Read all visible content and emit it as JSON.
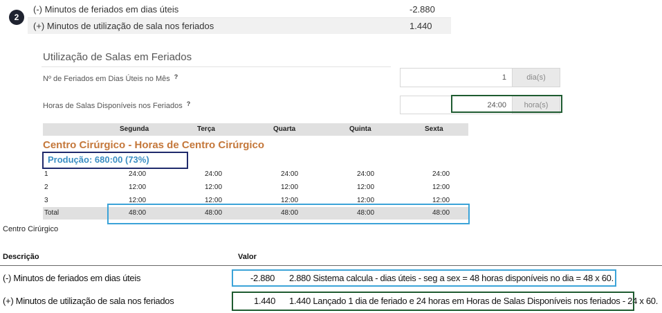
{
  "step_badge": "2",
  "top_summary": {
    "rows": [
      {
        "label": "(-) Minutos de feriados em dias úteis",
        "value": "-2.880"
      },
      {
        "label": "(+) Minutos de utilização de sala nos feriados",
        "value": "1.440"
      }
    ]
  },
  "form": {
    "title": "Utilização de Salas em Feriados",
    "fields": [
      {
        "label": "Nº de Feriados em Dias Úteis no Mês",
        "help": "?",
        "value": "1",
        "unit": "dia(s)"
      },
      {
        "label": "Horas de Salas Disponíveis nos Feriados",
        "help": "?",
        "value": "24:00",
        "unit": "hora(s)"
      }
    ]
  },
  "schedule": {
    "days": [
      "Segunda",
      "Terça",
      "Quarta",
      "Quinta",
      "Sexta"
    ],
    "center_title": "Centro Cirúrgico - Horas de Centro Cirúrgico",
    "production": "Produção: 680:00 (73%)",
    "rows": [
      {
        "label": "1",
        "values": [
          "24:00",
          "24:00",
          "24:00",
          "24:00",
          "24:00"
        ]
      },
      {
        "label": "2",
        "values": [
          "12:00",
          "12:00",
          "12:00",
          "12:00",
          "12:00"
        ]
      },
      {
        "label": "3",
        "values": [
          "12:00",
          "12:00",
          "12:00",
          "12:00",
          "12:00"
        ]
      },
      {
        "label": "Total",
        "values": [
          "48:00",
          "48:00",
          "48:00",
          "48:00",
          "48:00"
        ]
      }
    ]
  },
  "report": {
    "section_label": "Centro Cirúrgico",
    "col_description": "Descrição",
    "col_value": "Valor",
    "rows": [
      {
        "description": "(-) Minutos de feriados em dias úteis",
        "value": "-2.880",
        "note": "2.880 Sistema calcula - dias úteis - seg a sex = 48 horas disponíveis no dia = 48 x 60."
      },
      {
        "description": "(+) Minutos de utilização de sala nos feriados",
        "value": "1.440",
        "note": "1.440 Lançado 1 dia de feriado e 24 horas em Horas de Salas Disponíveis nos feriados - 24 x 60."
      }
    ]
  },
  "colors": {
    "highlight_green": "#1e5b30",
    "highlight_blue": "#3ba3d8",
    "highlight_navy": "#1f2a6b",
    "center_title": "#c4773a",
    "production_text": "#3a8ec3"
  }
}
